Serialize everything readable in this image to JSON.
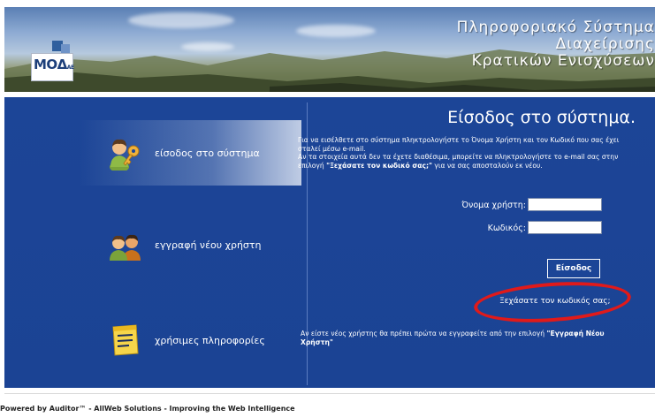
{
  "header": {
    "logo_text": "ΜΟΔ",
    "logo_suffix": "ΑΕ",
    "title_lines": [
      "Πληροφοριακό Σύστημα",
      "Διαχείρισης",
      "Κρατικών Ενισχύσεων"
    ]
  },
  "nav": [
    {
      "label": "είσοδος στο σύστημα",
      "icon": "user-key-icon",
      "active": true
    },
    {
      "label": "εγγραφή νέου χρήστη",
      "icon": "users-icon",
      "active": false
    },
    {
      "label": "χρήσιμες πληροφορίες",
      "icon": "notepad-icon",
      "active": false
    }
  ],
  "login": {
    "title": "Είσοδος στο σύστημα.",
    "intro_part1": "Για να εισέλθετε στο σύστημα πληκτρολογήστε το Όνομα Χρήστη και τον Κωδικό που σας έχει σταλεί μέσω e-mail.",
    "intro_part2": "Αν τα στοιχεία αυτά δεν τα έχετε διαθέσιμα, μπορείτε να πληκτρολογήστε το e-mail σας στην επιλογή ",
    "intro_link": "\"Ξεχάσατε τον κωδικό σας;\"",
    "intro_part3": " για να σας αποσταλούν εκ νέου.",
    "username_label": "Όνομα χρήστη:",
    "username_value": "",
    "password_label": "Κωδικός:",
    "password_value": "",
    "submit_label": "Είσοδος",
    "forgot_label": "Ξεχάσατε τον κωδικός σας;",
    "highlight_color": "#e01a1a"
  },
  "new_user": {
    "text_part1": "Αν είστε νέος χρήστης θα πρέπει πρώτα να εγγραφείτε από την επιλογή ",
    "text_link": "\"Εγγραφή Νέου Χρήστη\""
  },
  "footer": {
    "text": "Powered by Auditor™ - AllWeb Solutions - Improving the Web Intelligence"
  },
  "colors": {
    "panel": "#1c4597",
    "text": "#ffffff"
  }
}
